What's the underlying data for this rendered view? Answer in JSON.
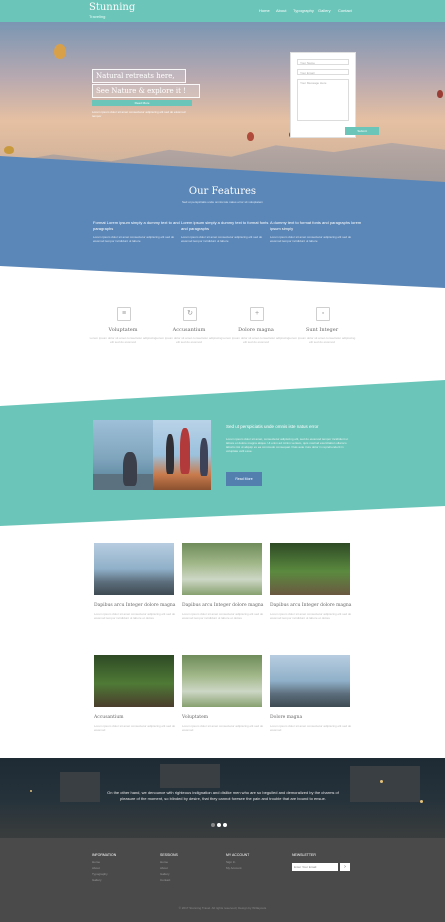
{
  "header": {
    "brand": "Stunning",
    "brand_sub": "Traveling",
    "nav": [
      "Home",
      "About",
      "Typography",
      "Gallery",
      "Contact"
    ]
  },
  "hero": {
    "title_line1": "Natural retreats here,",
    "title_line2": "See Nature & explore it !",
    "button": "Read More",
    "text": "Lorem ipsum dolor sit amet consectetur adipiscing elit sed do eiusmod tempor",
    "form": {
      "name_placeholder": "Your Name",
      "email_placeholder": "Your Email",
      "message_placeholder": "Your Message Here",
      "submit": "Submit"
    }
  },
  "features": {
    "title": "Our Features",
    "subtitle": "Sed ut perspiciatis unde omnis iste natus error sit voluptatem",
    "columns": [
      {
        "heading": "Format Lorem ipsum simply a dummy text to and paragraphs",
        "text": "Lorem ipsum dolor sit amet consectetur adipiscing elit sed do eiusmod tempor incididunt ut labore"
      },
      {
        "heading": "Lorem ipsum simply a dummy text to format fonts and paragraphs",
        "text": "Lorem ipsum dolor sit amet consectetur adipiscing elit sed do eiusmod tempor incididunt ut labore"
      },
      {
        "heading": "A dummy text to format fonts and paragraphs lorem ipsum simply",
        "text": "Lorem ipsum dolor sit amet consectetur adipiscing elit sed do eiusmod tempor incididunt ut labore"
      }
    ]
  },
  "icons": [
    {
      "label": "Voluptatem",
      "text": "Lorem ipsum dolor sit amet consectetur adipiscing elit sed do eiusmod",
      "icon": "menu-icon"
    },
    {
      "label": "Accusantium",
      "text": "Lorem ipsum dolor sit amet consectetur adipiscing elit sed do eiusmod",
      "icon": "refresh-icon"
    },
    {
      "label": "Dolore magna",
      "text": "Lorem ipsum dolor sit amet consectetur adipiscing elit sed do eiusmod",
      "icon": "plus-icon"
    },
    {
      "label": "Sunt Integer",
      "text": "Lorem ipsum dolor sit amet consectetur adipiscing elit sed do eiusmod",
      "icon": "file-icon"
    }
  ],
  "teal": {
    "title": "Sed ut perspiciatis unde omnis iste natus error",
    "text": "Lorem ipsum dolor sit amet, consectetur adipiscing elit, sed do eiusmod tempor incididunt ut labore et dolore magna aliqua. Ut enim ad minim veniam, quis nostrud exercitation ullamco laboris nisi ut aliquip ex ea commodo consequat. Duis aute irure dolor in reprehenderit in voluptate velit esse.",
    "button": "Read More"
  },
  "gallery": [
    {
      "title": "Dapibus arcu Integer dolore magna",
      "text": "Lorem ipsum dolor sit amet consectetur adipiscing elit sed do eiusmod tempor incididunt ut labore et dolore"
    },
    {
      "title": "Dapibus arcu Integer dolore magna",
      "text": "Lorem ipsum dolor sit amet consectetur adipiscing elit sed do eiusmod tempor incididunt ut labore et dolore"
    },
    {
      "title": "Dapibus arcu Integer dolore magna",
      "text": "Lorem ipsum dolor sit amet consectetur adipiscing elit sed do eiusmod tempor incididunt ut labore et dolore"
    },
    {
      "title": "Accusantium",
      "text": "Lorem ipsum dolor sit amet consectetur adipiscing elit sed do eiusmod"
    },
    {
      "title": "Voluptatem",
      "text": "Lorem ipsum dolor sit amet consectetur adipiscing elit sed do eiusmod"
    },
    {
      "title": "Dolore magna",
      "text": "Lorem ipsum dolor sit amet consectetur adipiscing elit sed do eiusmod"
    }
  ],
  "dark": {
    "text": "On the other hand, we denounce with righteous indignation and dislike men who are so beguiled and demoralized by the charms of pleasure of the moment, so blinded by desire, that they cannot foresee the pain and trouble that are bound to ensue."
  },
  "footer": {
    "columns": [
      {
        "heading": "INFORMATION",
        "links": [
          "Home",
          "About",
          "Typography",
          "Gallery"
        ]
      },
      {
        "heading": "SESSIONS",
        "links": [
          "Home",
          "About",
          "Gallery",
          "Contact"
        ]
      },
      {
        "heading": "MY ACCOUNT",
        "links": [
          "Sign In",
          "My Account"
        ]
      },
      {
        "heading": "NEWSLETTER",
        "links": []
      }
    ],
    "newsletter_placeholder": "Enter Your Email",
    "newsletter_button": "›",
    "copyright": "© 2017 Stunning Travel. All rights reserved | Design by W3layouts"
  },
  "colors": {
    "teal": "#6cc5b9",
    "blue": "#5b87b8",
    "footer": "#4a4a4a"
  }
}
